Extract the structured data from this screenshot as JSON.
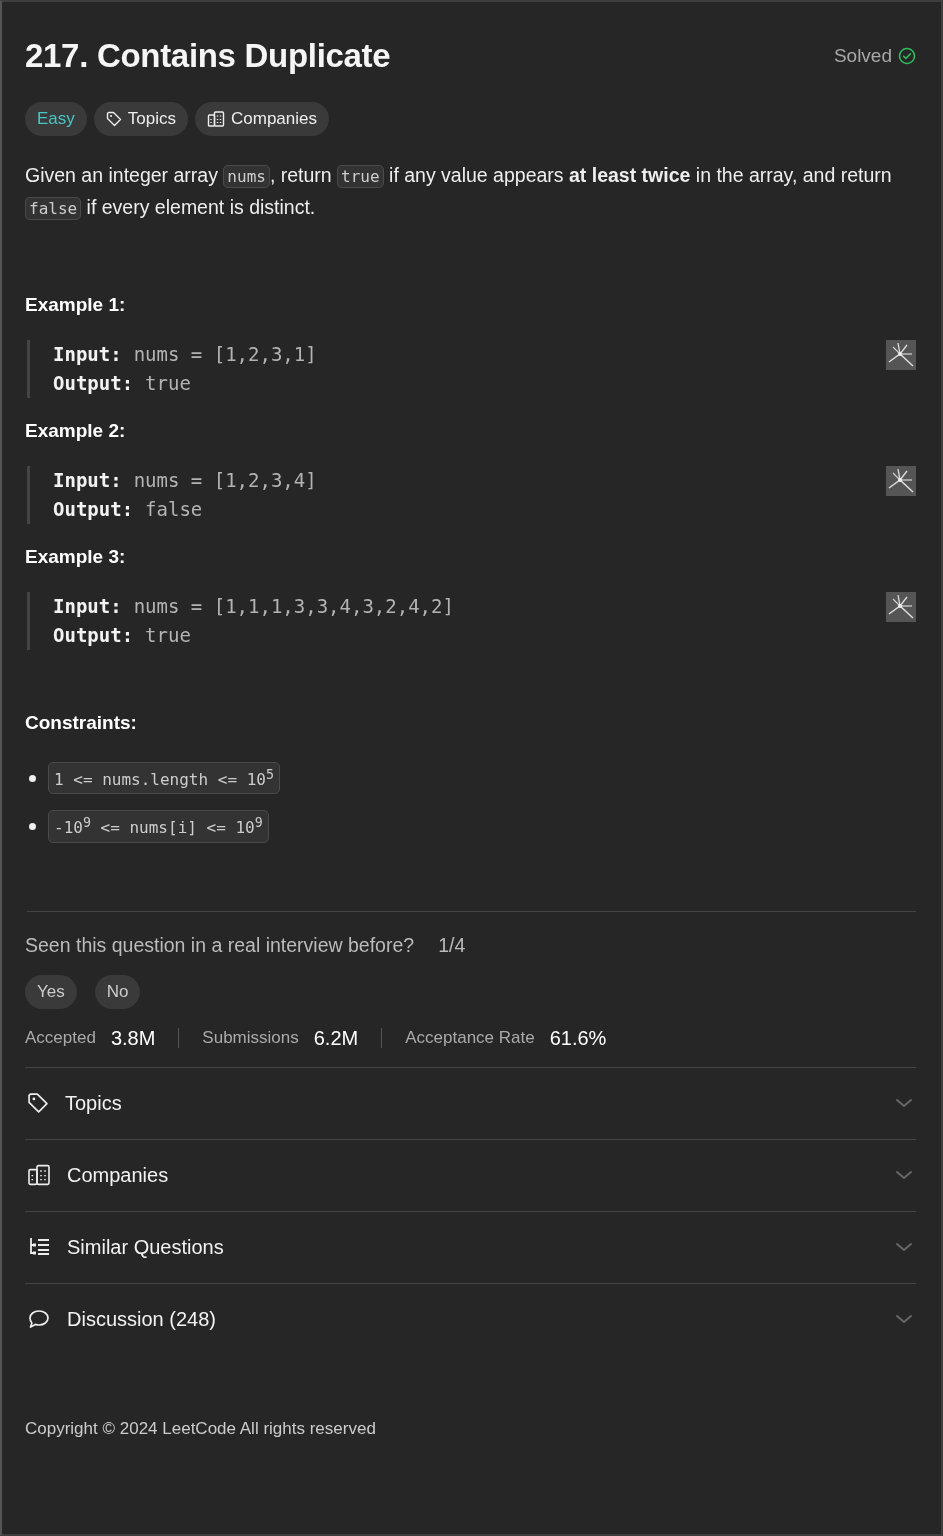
{
  "problem": {
    "title": "217. Contains Duplicate",
    "status": "Solved",
    "solved": true,
    "tags": [
      {
        "kind": "difficulty",
        "label": "Easy"
      },
      {
        "kind": "topics",
        "label": "Topics"
      },
      {
        "kind": "companies",
        "label": "Companies"
      }
    ],
    "description": [
      {
        "kind": "text",
        "text": "Given an integer array "
      },
      {
        "kind": "code",
        "text": "nums"
      },
      {
        "kind": "text",
        "text": ", return "
      },
      {
        "kind": "code",
        "text": "true"
      },
      {
        "kind": "text",
        "text": " if any value appears "
      },
      {
        "kind": "bold",
        "text": "at least twice"
      },
      {
        "kind": "text",
        "text": " in the array, and return "
      },
      {
        "kind": "code",
        "text": "false"
      },
      {
        "kind": "text",
        "text": " if every element is distinct."
      }
    ],
    "examples": [
      {
        "title": "Example 1:",
        "input_label": "Input:",
        "input": "nums = [1,2,3,1]",
        "output_label": "Output:",
        "output": "true"
      },
      {
        "title": "Example 2:",
        "input_label": "Input:",
        "input": "nums = [1,2,3,4]",
        "output_label": "Output:",
        "output": "false"
      },
      {
        "title": "Example 3:",
        "input_label": "Input:",
        "input": "nums = [1,1,1,3,3,4,3,2,4,2]",
        "output_label": "Output:",
        "output": "true"
      }
    ],
    "constraints_title": "Constraints:",
    "constraints": [
      "1 <= nums.length <= 10$^{5}$",
      "-10$^{9}$ <= nums[i] <= 10$^{9}$"
    ]
  },
  "interview": {
    "question": "Seen this question in a real interview before?",
    "count": "1/4",
    "buttons": [
      "Yes",
      "No"
    ]
  },
  "stats": [
    {
      "label": "Accepted",
      "value": "3.8M"
    },
    {
      "label": "Submissions",
      "value": "6.2M"
    },
    {
      "label": "Acceptance Rate",
      "value": "61.6%"
    }
  ],
  "sections": [
    {
      "kind": "topics",
      "label": "Topics",
      "expanded": false
    },
    {
      "kind": "companies",
      "label": "Companies",
      "expanded": false
    },
    {
      "kind": "similar",
      "label": "Similar Questions",
      "expanded": false
    },
    {
      "kind": "discussion",
      "label": "Discussion (248)",
      "expanded": false
    }
  ],
  "footer": "Copyright © 2024 LeetCode All rights reserved"
}
